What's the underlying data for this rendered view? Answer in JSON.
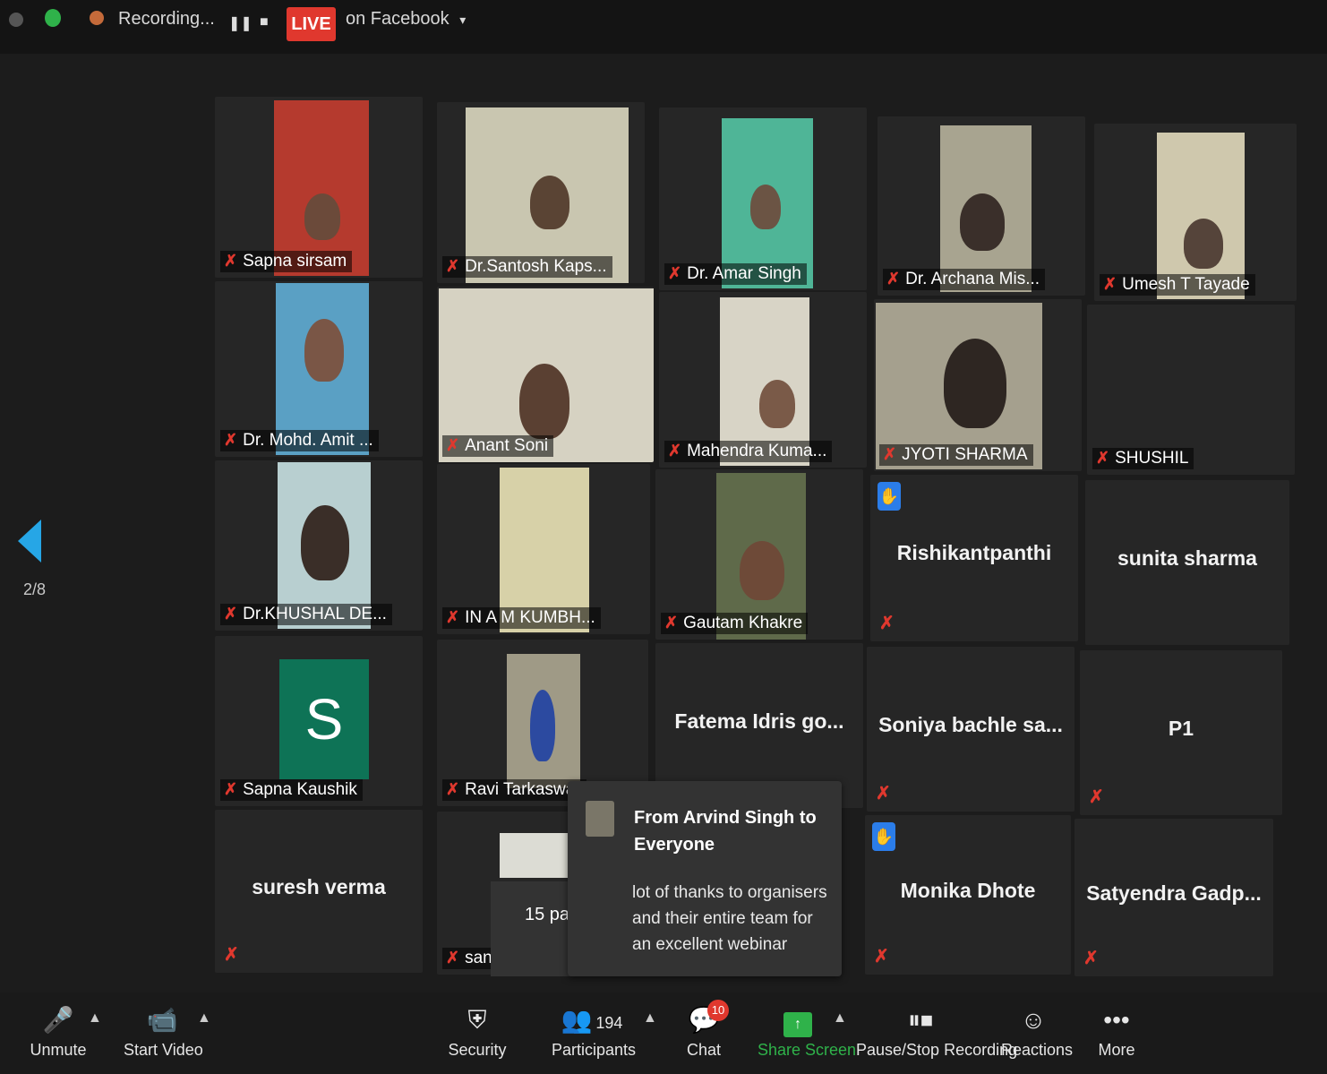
{
  "topbar": {
    "recording_label": "Recording...",
    "live_label": "LIVE",
    "stream_label": "on Facebook",
    "stream_caret": "▾"
  },
  "page_indicator": "2/8",
  "tiles": {
    "r1c1": "Sapna sirsam",
    "r1c2": "Dr.Santosh Kaps...",
    "r1c3": "Dr. Amar Singh",
    "r1c4": "Dr. Archana Mis...",
    "r1c5": "Umesh T Tayade",
    "r2c1": "Dr. Mohd. Amit ...",
    "r2c2": "Anant Soni",
    "r2c3": "Mahendra Kuma...",
    "r2c4": "JYOTI SHARMA",
    "r2c5": "SHUSHIL",
    "r3c1": "Dr.KHUSHAL DE...",
    "r3c2": "IN  A M KUMBH...",
    "r3c3": "Gautam Khakre",
    "r3c4": "Rishikantpanthi",
    "r3c5": "sunita sharma",
    "r4c1": "Sapna Kaushik",
    "r4c1_avatar": "S",
    "r4c2": "Ravi Tarkaswar",
    "r4c3": "Fatema Idris go...",
    "r4c4": "Soniya bachle sa...",
    "r4c5": "P1",
    "r5c1": "suresh verma",
    "r5c2": "sanja",
    "r5c4": "Monika  Dhote",
    "r5c5": "Satyendra  Gadp..."
  },
  "partial_tile_text": "15 part",
  "chat_popup": {
    "from": "From Arvind Singh to Everyone",
    "message": "lot of thanks to organisers and their entire team for an excellent webinar"
  },
  "toolbar": {
    "unmute": "Unmute",
    "start_video": "Start Video",
    "security": "Security",
    "participants": "Participants",
    "participants_count": "194",
    "chat": "Chat",
    "chat_badge": "10",
    "share_screen": "Share Screen",
    "pause_stop_recording": "Pause/Stop Recording",
    "reactions": "Reactions",
    "more": "More"
  },
  "colors": {
    "live": "#e0382e",
    "share_screen": "#2fb24a",
    "raise_hand": "#2b7de9",
    "nav_arrow": "#26a6e6",
    "avatar_bg": "#0e7356"
  }
}
